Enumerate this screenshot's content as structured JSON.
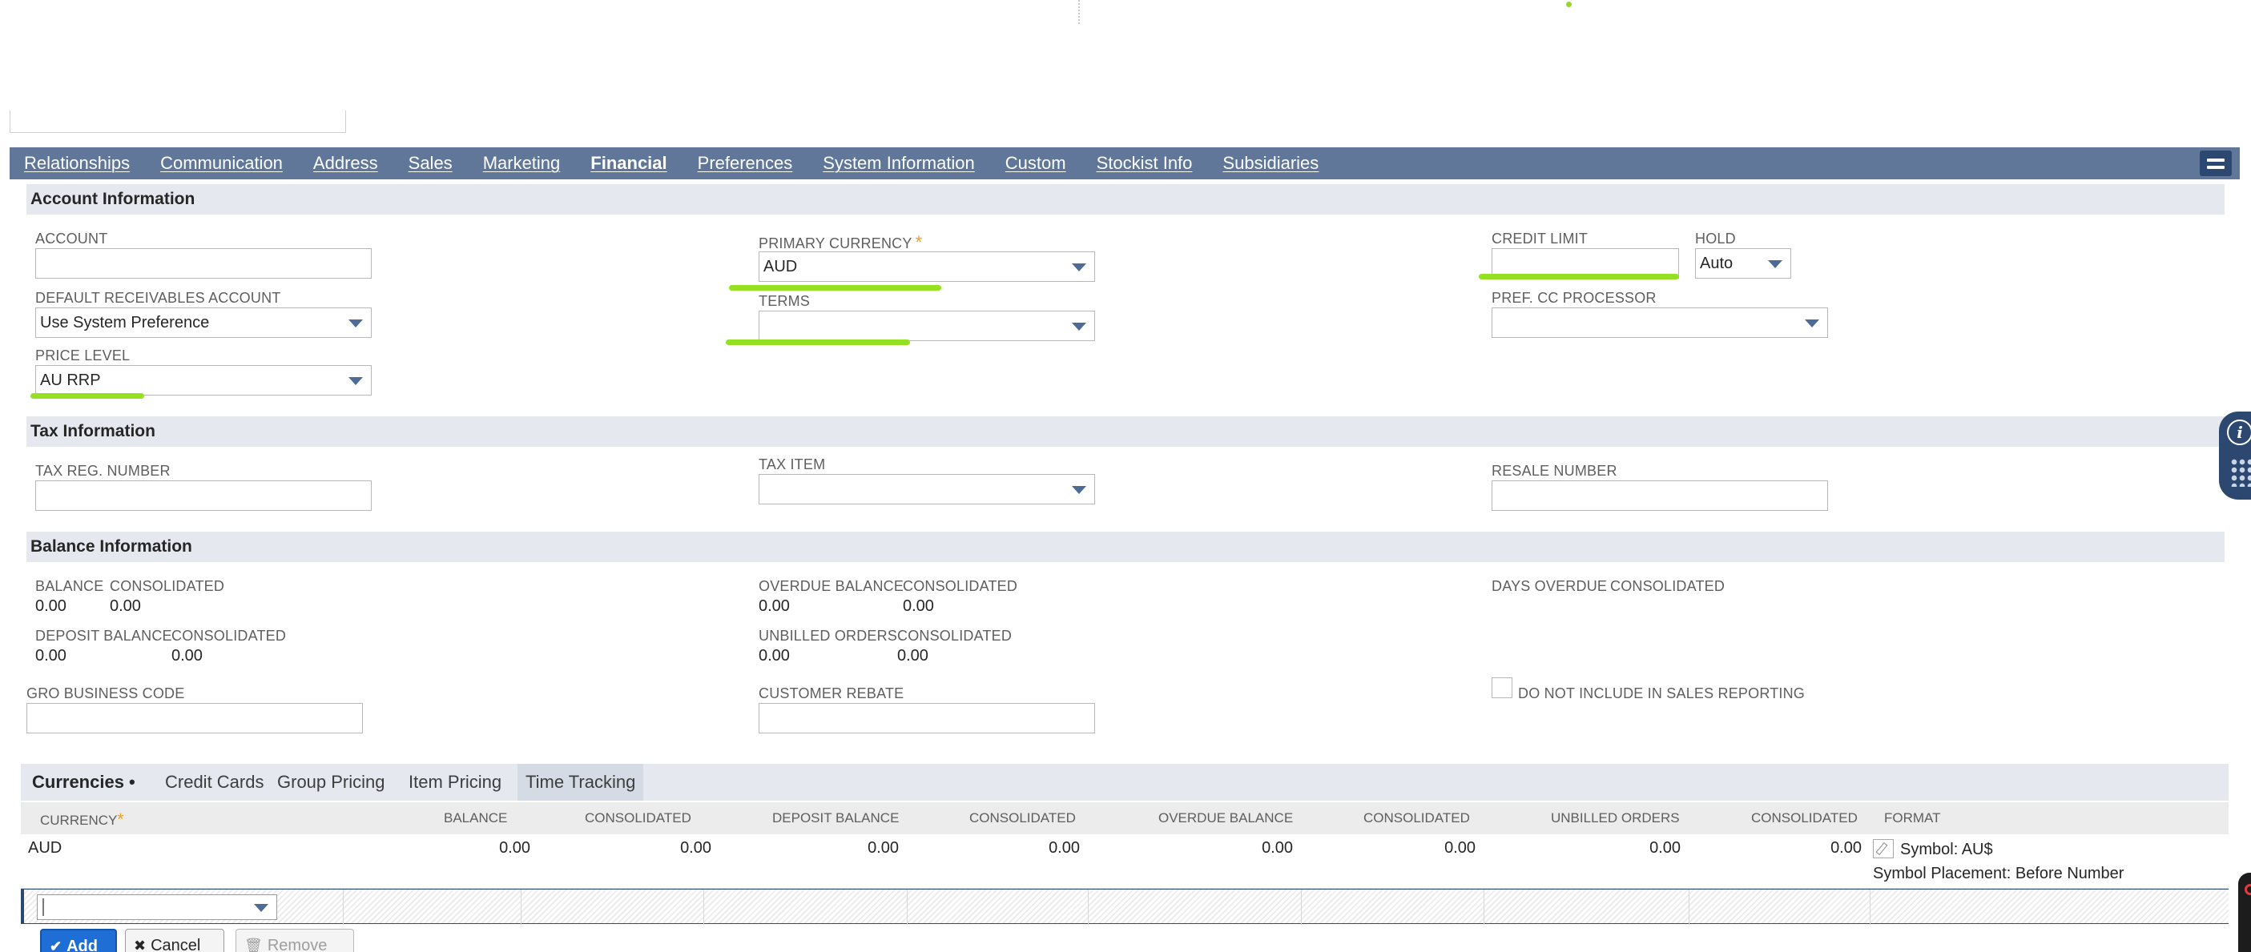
{
  "main_tabs": [
    {
      "label": "Relationships"
    },
    {
      "label": "Communication"
    },
    {
      "label": "Address"
    },
    {
      "label": "Sales"
    },
    {
      "label": "Marketing"
    },
    {
      "label": "Financial",
      "active": true
    },
    {
      "label": "Preferences"
    },
    {
      "label": "System Information"
    },
    {
      "label": "Custom"
    },
    {
      "label": "Stockist Info"
    },
    {
      "label": "Subsidiaries"
    }
  ],
  "account_info": {
    "header": "Account Information",
    "account_label": "ACCOUNT",
    "account_value": "",
    "default_receivables_label": "DEFAULT RECEIVABLES ACCOUNT",
    "default_receivables_value": "Use System Preference",
    "price_level_label": "PRICE LEVEL",
    "price_level_value": "AU RRP",
    "primary_currency_label": "PRIMARY CURRENCY",
    "primary_currency_required": "*",
    "primary_currency_value": "AUD",
    "terms_label": "TERMS",
    "terms_value": "",
    "credit_limit_label": "CREDIT LIMIT",
    "credit_limit_value": "",
    "hold_label": "HOLD",
    "hold_value": "Auto",
    "pref_cc_label": "PREF. CC PROCESSOR",
    "pref_cc_value": ""
  },
  "tax_info": {
    "header": "Tax Information",
    "tax_reg_label": "TAX REG. NUMBER",
    "tax_item_label": "TAX ITEM",
    "resale_label": "RESALE NUMBER"
  },
  "balance_info": {
    "header": "Balance Information",
    "balance_label": "BALANCE",
    "balance_value": "0.00",
    "balance_consol_label": "CONSOLIDATED",
    "balance_consol_value": "0.00",
    "deposit_label": "DEPOSIT BALANCE",
    "deposit_value": "0.00",
    "deposit_consol_label": "CONSOLIDATED",
    "deposit_consol_value": "0.00",
    "overdue_label": "OVERDUE BALANCE",
    "overdue_value": "0.00",
    "overdue_consol_label": "CONSOLIDATED",
    "overdue_consol_value": "0.00",
    "unbilled_label": "UNBILLED ORDERS",
    "unbilled_value": "0.00",
    "unbilled_consol_label": "CONSOLIDATED",
    "unbilled_consol_value": "0.00",
    "days_overdue_label": "DAYS OVERDUE",
    "days_overdue_consol_label": "CONSOLIDATED",
    "gro_label": "GRO BUSINESS CODE",
    "rebate_label": "CUSTOMER REBATE",
    "do_not_include_label": "DO NOT INCLUDE IN SALES REPORTING",
    "do_not_include_checked": false
  },
  "subtabs": [
    {
      "label": "Currencies •",
      "active": true
    },
    {
      "label": "Credit Cards"
    },
    {
      "label": "Group Pricing"
    },
    {
      "label": "Item Pricing"
    },
    {
      "label": "Time Tracking"
    }
  ],
  "currency_grid": {
    "columns": [
      "CURRENCY",
      "BALANCE",
      "CONSOLIDATED",
      "DEPOSIT BALANCE",
      "CONSOLIDATED",
      "OVERDUE BALANCE",
      "CONSOLIDATED",
      "UNBILLED ORDERS",
      "CONSOLIDATED",
      "FORMAT"
    ],
    "required_marker": "*",
    "rows": [
      {
        "currency": "AUD",
        "balance": "0.00",
        "balance_consol": "0.00",
        "deposit": "0.00",
        "deposit_consol": "0.00",
        "overdue": "0.00",
        "overdue_consol": "0.00",
        "unbilled": "0.00",
        "unbilled_consol": "0.00",
        "format_symbol": "Symbol: AU$",
        "format_placement": "Symbol Placement: Before Number"
      }
    ]
  },
  "buttons": {
    "add": "Add",
    "cancel": "Cancel",
    "remove": "Remove"
  },
  "colors": {
    "tab_bar": "#607799",
    "section_bg": "#e5e9ef",
    "highlight_marker": "#95e021",
    "required": "#e8a02a",
    "primary_button": "#1f6ed6"
  }
}
